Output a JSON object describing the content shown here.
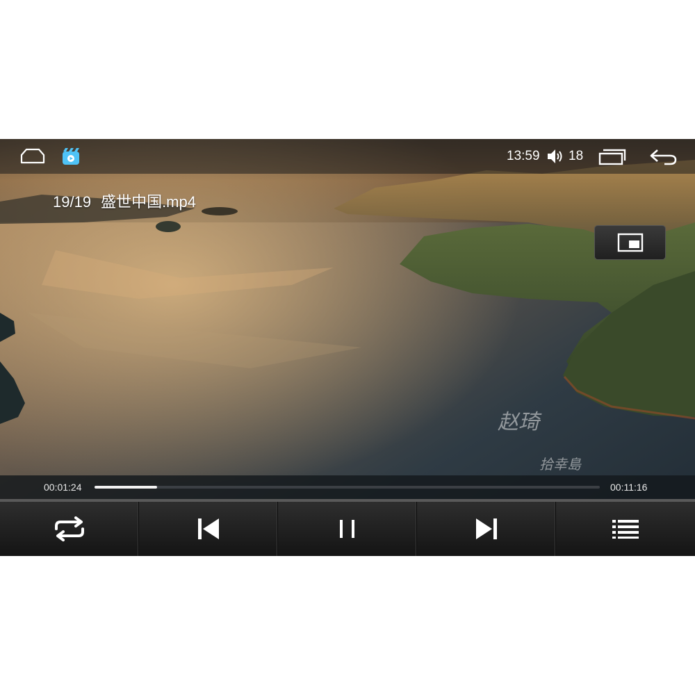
{
  "status_bar": {
    "home_icon": "home-icon",
    "app_icon": "video-player-app-icon",
    "time": "13:59",
    "volume_icon": "volume-icon",
    "volume_level": "18",
    "recents_icon": "recents-icon",
    "back_icon": "back-arrow-icon"
  },
  "video": {
    "index": "19/19",
    "filename": "盛世中国.mp4",
    "watermark_line1": "赵琦",
    "watermark_line2": "拾幸島"
  },
  "playback": {
    "elapsed": "00:01:24",
    "duration": "00:11:16",
    "progress_fraction": 0.124
  },
  "controls": {
    "repeat_icon": "repeat-icon",
    "previous_icon": "skip-previous-icon",
    "pause_icon": "pause-icon",
    "next_icon": "skip-next-icon",
    "playlist_icon": "playlist-icon",
    "pip_icon": "picture-in-picture-icon"
  },
  "colors": {
    "progress_fill": "#f2f2f2",
    "progress_track": "#3b3f44",
    "app_icon_accent": "#4fc3f7"
  }
}
